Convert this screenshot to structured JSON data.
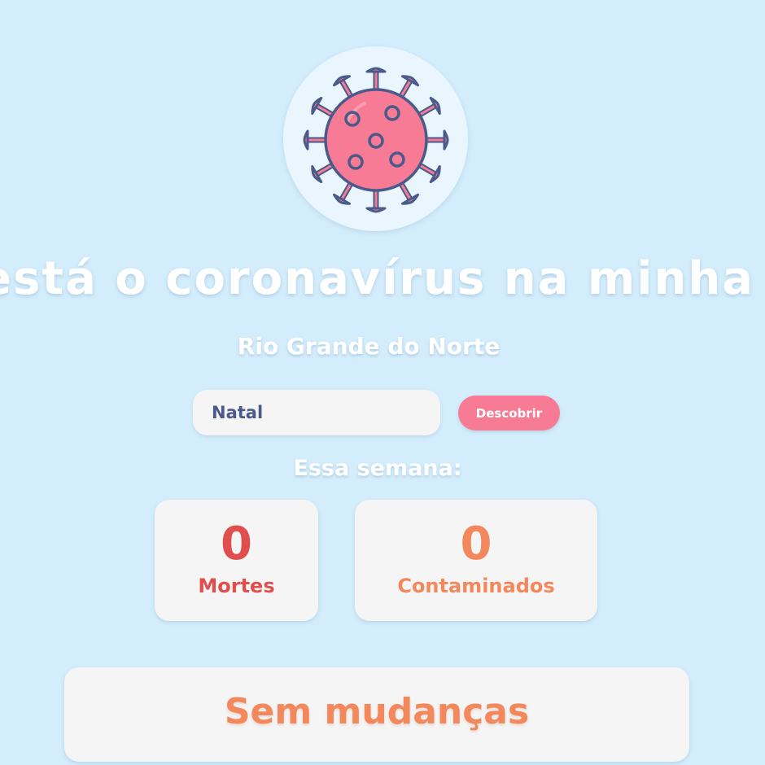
{
  "logo": {
    "icon": "virus-icon"
  },
  "headline": "está o coronavírus na minha ci",
  "state": "Rio Grande do Norte",
  "search": {
    "value": "Natal",
    "button_label": "Descobrir"
  },
  "week_label": "Essa semana:",
  "stats": {
    "deaths": {
      "value": "0",
      "label": "Mortes"
    },
    "cases": {
      "value": "0",
      "label": "Contaminados"
    }
  },
  "status": "Sem mudanças",
  "colors": {
    "background": "#d3edfc",
    "accent_pink": "#f77b94",
    "deaths_red": "#e04e4e",
    "cases_orange": "#f3885c",
    "card": "#f5f5f5"
  }
}
